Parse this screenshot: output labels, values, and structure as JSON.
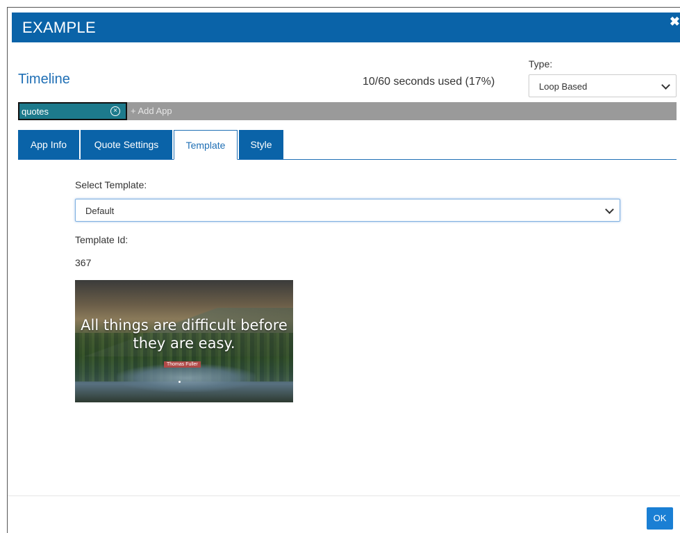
{
  "modal": {
    "title": "EXAMPLE",
    "close_icon": "close-icon"
  },
  "timeline": {
    "title": "Timeline",
    "seconds_used": "10/60 seconds used (17%)",
    "type_label": "Type:",
    "type_value": "Loop Based"
  },
  "apps": {
    "items": [
      {
        "label": "quotes"
      }
    ],
    "add_placeholder": "+ Add App"
  },
  "tabs": [
    {
      "label": "App Info",
      "active": false
    },
    {
      "label": "Quote Settings",
      "active": false
    },
    {
      "label": "Template",
      "active": true
    },
    {
      "label": "Style",
      "active": false
    }
  ],
  "template": {
    "select_label": "Select Template:",
    "selected": "Default",
    "id_label": "Template Id:",
    "id_value": "367",
    "preview": {
      "quote": "All things are difficult before they are easy.",
      "author": "Thomas Fuller"
    }
  },
  "footer": {
    "ok_label": "OK"
  },
  "colors": {
    "header": "#0a63a8",
    "accent": "#1f6fb5",
    "chip": "#1d7a8c",
    "ok_button": "#1a7fd4"
  }
}
